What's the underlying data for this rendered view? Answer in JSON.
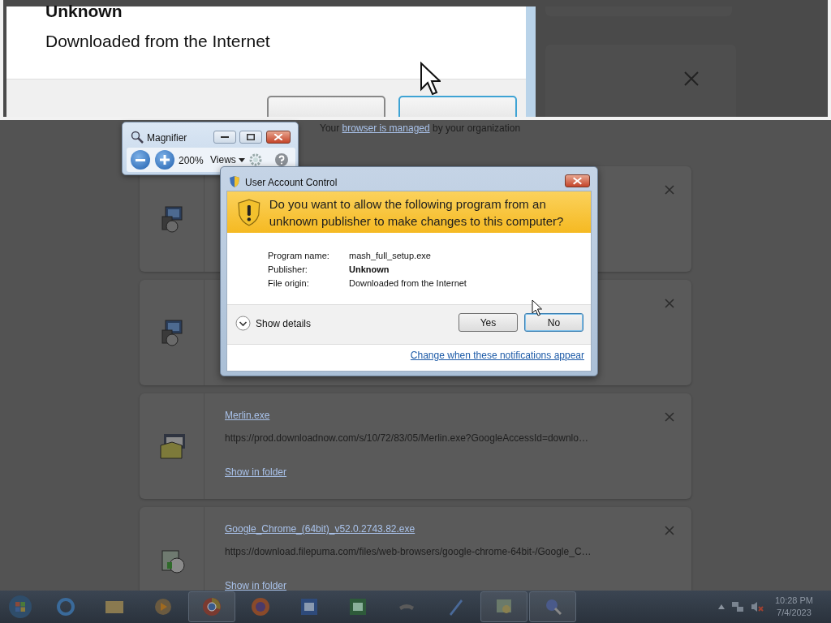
{
  "magnifier_view": {
    "publisher": "Unknown",
    "file_origin": "Downloaded from the Internet",
    "buttons": [
      {
        "selected": false
      },
      {
        "selected": true
      }
    ]
  },
  "magnifier": {
    "title": "Magnifier",
    "zoom": "200%",
    "views": "Views"
  },
  "managed_notice": {
    "before": "Your",
    "link": "browser is managed",
    "after": "by your organization"
  },
  "uac": {
    "title": "User Account Control",
    "question": "Do you want to allow the following program from an unknown publisher to make changes to this computer?",
    "fields": [
      {
        "label": "Program name:",
        "value": "mash_full_setup.exe",
        "bold": false
      },
      {
        "label": "Publisher:",
        "value": "Unknown",
        "bold": true
      },
      {
        "label": "File origin:",
        "value": "Downloaded from the Internet",
        "bold": false
      }
    ],
    "show_details": "Show details",
    "buttons": [
      {
        "label": "Yes",
        "selected": false
      },
      {
        "label": "No",
        "selected": true
      }
    ],
    "link": "Change when these notifications appear"
  },
  "downloads": [
    {
      "kind": "covered"
    },
    {
      "kind": "covered"
    },
    {
      "kind": "file",
      "name": "Merlin.exe",
      "url": "https://prod.downloadnow.com/s/10/72/83/05/Merlin.exe?GoogleAccessId=downlo…",
      "action": "Show in folder"
    },
    {
      "kind": "file",
      "name": "Google_Chrome_(64bit)_v52.0.2743.82.exe",
      "url": "https://download.filepuma.com/files/web-browsers/google-chrome-64bit-/Google_C…",
      "action": "Show in folder"
    }
  ],
  "taskbar": {
    "apps": [
      {
        "running": false
      },
      {
        "running": false
      },
      {
        "running": false
      },
      {
        "running": true
      },
      {
        "running": false
      },
      {
        "running": false
      },
      {
        "running": false
      },
      {
        "running": false
      },
      {
        "running": false
      },
      {
        "running": true
      },
      {
        "running": true
      }
    ],
    "time": "10:28 PM",
    "date": "7/4/2023"
  }
}
